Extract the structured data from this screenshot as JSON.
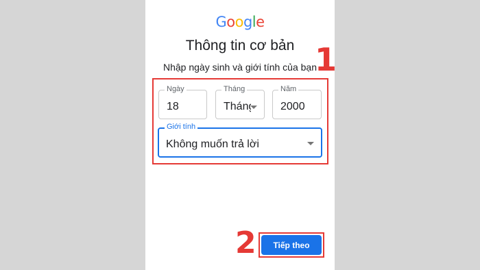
{
  "logo": {
    "letters": [
      "G",
      "o",
      "o",
      "g",
      "l",
      "e"
    ],
    "colors": [
      "#4285F4",
      "#EA4335",
      "#FBBC05",
      "#4285F4",
      "#34A853",
      "#EA4335"
    ]
  },
  "title": "Thông tin cơ bản",
  "subtitle": "Nhập ngày sinh và giới tính của bạn",
  "birthday": {
    "day": {
      "label": "Ngày",
      "value": "18"
    },
    "month": {
      "label": "Tháng",
      "value": "Tháng"
    },
    "year": {
      "label": "Năm",
      "value": "2000"
    }
  },
  "gender": {
    "label": "Giới tính",
    "value": "Không muốn trả lời"
  },
  "next_button": "Tiếp theo",
  "annotations": {
    "step1": "1",
    "step2": "2"
  },
  "colors": {
    "accent": "#1a73e8",
    "highlight": "#e53935"
  }
}
